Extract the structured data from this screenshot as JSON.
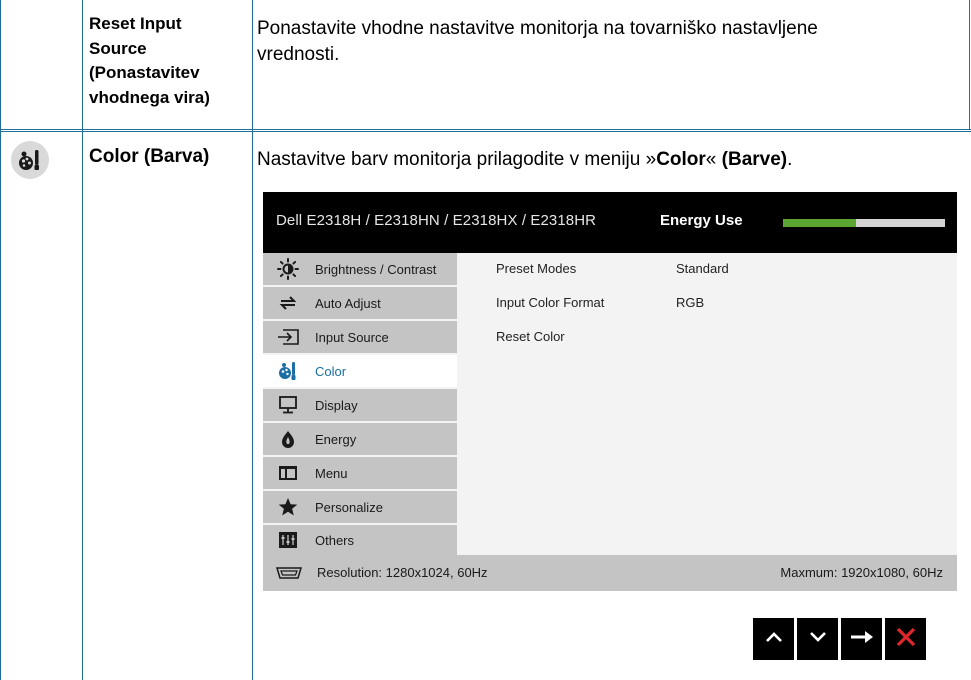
{
  "rows": [
    {
      "name_lines": [
        "Reset Input",
        "Source",
        "(Ponastavitev",
        "vhodnega vira)"
      ],
      "desc_lines": [
        "Ponastavite vhodne nastavitve monitorja na tovarniško nastavljene",
        "vrednosti."
      ]
    },
    {
      "icon": "color-palette-icon",
      "name": "Color (Barva)",
      "desc_prefix": "Nastavitve barv monitorja prilagodite v meniju »",
      "desc_bold1": "Color",
      "desc_mid": "« ",
      "desc_bold2": "(Barve)",
      "desc_suffix": "."
    }
  ],
  "osd": {
    "model": "Dell E2318H / E2318HN / E2318HX / E2318HR",
    "energy_label": "Energy Use",
    "energy_level_percent": 45,
    "energy_color": "#5ba633",
    "menu": [
      {
        "label": "Brightness / Contrast",
        "icon": "brightness-icon"
      },
      {
        "label": "Auto Adjust",
        "icon": "auto-adjust-icon"
      },
      {
        "label": "Input Source",
        "icon": "input-source-icon"
      },
      {
        "label": "Color",
        "icon": "color-icon",
        "active": true
      },
      {
        "label": "Display",
        "icon": "display-icon"
      },
      {
        "label": "Energy",
        "icon": "energy-icon"
      },
      {
        "label": "Menu",
        "icon": "menu-icon"
      },
      {
        "label": "Personalize",
        "icon": "star-icon"
      },
      {
        "label": "Others",
        "icon": "others-icon"
      }
    ],
    "submenu": [
      {
        "label": "Preset Modes",
        "value": "Standard"
      },
      {
        "label": "Input Color Format",
        "value": "RGB"
      },
      {
        "label": "Reset Color",
        "value": ""
      }
    ],
    "footer": {
      "resolution": "Resolution: 1280x1024, 60Hz",
      "maximum": "Maxmum: 1920x1080, 60Hz"
    },
    "active_color": "#1b6fa3"
  },
  "nav_buttons": [
    {
      "icon": "chevron-up-icon"
    },
    {
      "icon": "chevron-down-icon"
    },
    {
      "icon": "arrow-right-icon"
    },
    {
      "icon": "close-icon"
    }
  ]
}
